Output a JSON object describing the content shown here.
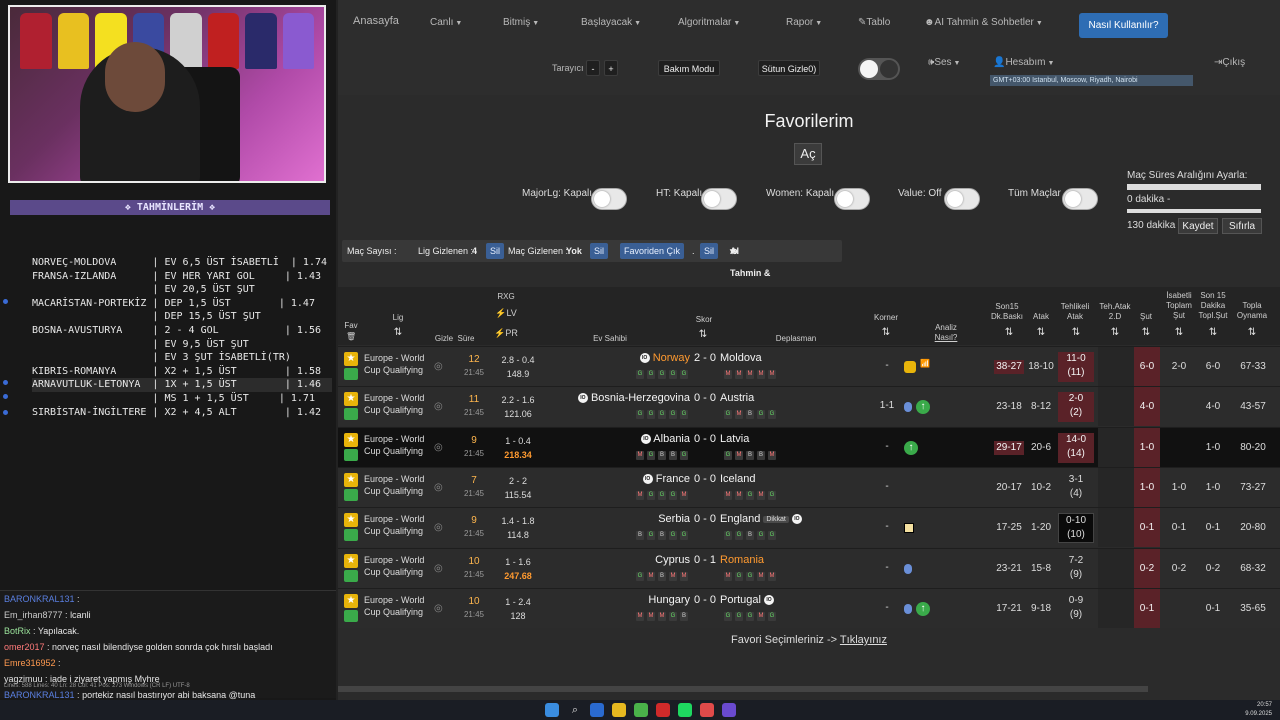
{
  "left": {
    "tahmin_title": "❖ TAHMİNLERİM ❖",
    "tahmin_lines": [
      "NORVEÇ-MOLDOVA      | EV 6,5 ÜST İSABETLİ  | 1.74",
      "FRANSA-IZLANDA      | EV HER YARI GOL     | 1.43",
      "                    | EV 20,5 ÜST ŞUT",
      "MACARİSTAN-PORTEKİZ | DEP 1,5 ÜST        | 1.47",
      "                    | DEP 15,5 ÜST ŞUT",
      "BOSNA-AVUSTURYA     | 2 - 4 GOL           | 1.56",
      "                    | EV 9,5 ÜST ŞUT",
      "                    | EV 3 ŞUT İSABETLİ(TR)",
      "KIBRIS-ROMANYA      | X2 + 1,5 ÜST        | 1.58",
      "ARNAVUTLUK-LETONYA  | 1X + 1,5 ÜST        | 1.46",
      "                    | MS 1 + 1,5 ÜST     | 1.71",
      "SIRBİSTAN-İNGİLTERE | X2 + 4,5 ALT        | 1.42"
    ],
    "chat": [
      {
        "user": "BARONKRAL131",
        "msg": "",
        "cls": "u1"
      },
      {
        "user": "Em_irhan8777",
        "msg": "lcanli",
        "cls": "u2"
      },
      {
        "user": "BotRix",
        "msg": "Yapılacak.",
        "cls": "bot"
      },
      {
        "user": "omer2017",
        "msg": "norveç nasıl bilendiyse golden sonrda çok hırslı başladı",
        "cls": "u3"
      },
      {
        "user": "Emre316952",
        "msg": "",
        "cls": "u4"
      },
      {
        "user": "yagzimuu",
        "msg": "iade i ziyaret yapmış Myhre",
        "cls": "u5"
      },
      {
        "user": "BARONKRAL131",
        "msg": "portekiz nasıl bastırıyor abi baksana @tuna",
        "cls": "u1"
      }
    ],
    "statusline": "Lines: 588  Lines: 40   Ln: 28  Col: 41  Pos: 273          Windows (CR LF)   UTF-8"
  },
  "nav": {
    "home": "Anasayfa",
    "items": [
      "Canlı",
      "Bitmiş",
      "Başlayacak",
      "Algoritmalar",
      "Rapor",
      "Tablo",
      "AI Tahmin & Sohbetler"
    ],
    "howto": "Nasıl Kullanılır?",
    "tarayici": "Tarayıcı",
    "minus": "-",
    "plus": "+",
    "bakim": "Bakım Modu",
    "sutun": "Sütun Gizle0)",
    "ses": "Ses",
    "hesabim": "Hesabım",
    "cikis": "Çıkış",
    "timezone": "GMT+03:00 Istanbul, Moscow, Riyadh, Nairobi"
  },
  "fav": {
    "title": "Favorilerim",
    "ac": "Aç",
    "toggles": [
      "MajorLg: Kapalı",
      "HT: Kapalı",
      "Women: Kapalı",
      "Value: Off",
      "Tüm Maçlar"
    ],
    "range_title": "Maç Süres Aralığını Ayarla:",
    "range_min": "0 dakika -",
    "range_max": "130 dakika",
    "kaydet": "Kaydet",
    "sifirla": "Sıfırla"
  },
  "filter": {
    "mac_sayisi": "Maç Sayısı :",
    "lig_gizlenen": "Lig Gizlenen :",
    "lig_gizlenen_val": "4",
    "sil1": "Sil",
    "mac_gizlenen": "Maç Gizlenen :",
    "mac_gizlenen_val": "Yok",
    "sil2": "Sil",
    "favoriden": "Favoriden Çık",
    "dot": ".",
    "sil3": "Sil",
    "ai": "AI Tahmin & Sohbetler"
  },
  "headers": {
    "fav": "Fav",
    "lig": "Lig",
    "gizle": "Gizle",
    "sure": "Süre",
    "rxg": "RXG",
    "lv": "LV",
    "pr": "PR",
    "ev": "Ev Sahibi",
    "skor": "Skor",
    "dep": "Deplasman",
    "korner": "Korner",
    "analiz": "Analiz",
    "nasil": "Nasıl?",
    "son15": "Son15",
    "dkbaski": "Dk.Baskı",
    "atak": "Atak",
    "tehlikeli": "Tehlikeli",
    "atak2": "Atak",
    "tehatak": "Teh.Atak",
    "tehatak2": "2.D",
    "sut": "Şut",
    "isabetli": "İsabetli",
    "toplam": "Toplam",
    "sut2": "Şut",
    "son15b": "Son 15",
    "dakika": "Dakika",
    "toplsut": "Topl.Şut",
    "topla": "Topla",
    "oynama": "Oynama"
  },
  "matches": [
    {
      "league": "Europe - World Cup Qualifying",
      "minute": "12",
      "time": "21:45",
      "odd": "2.8 - 0.4",
      "rxg": "148.9",
      "rxg_hi": false,
      "home": "Norway",
      "home_org": true,
      "home_io": true,
      "score": "2 - 0",
      "away": "Moldova",
      "away_org": false,
      "away_io": false,
      "dikkat": false,
      "hform": [
        "G",
        "G",
        "G",
        "G",
        "G"
      ],
      "aform": [
        "M",
        "M",
        "M",
        "M",
        "M"
      ],
      "korner": "-",
      "anz": "bag",
      "baski": "38-27",
      "baski_red": true,
      "atak": "18-10",
      "teh": "11-0",
      "teh2": "(11)",
      "teh_red": true,
      "teh_blk": false,
      "sut": "6-0",
      "isb": "2-0",
      "son15": "6-0",
      "oyn": "67-33",
      "dark": false
    },
    {
      "league": "Europe - World Cup Qualifying",
      "minute": "11",
      "time": "21:45",
      "odd": "2.2 - 1.6",
      "rxg": "121.06",
      "rxg_hi": false,
      "home": "Bosnia-Herzegovina",
      "home_org": false,
      "home_io": true,
      "score": "0 - 0",
      "away": "Austria",
      "away_org": false,
      "away_io": false,
      "dikkat": false,
      "hform": [
        "G",
        "G",
        "G",
        "G",
        "G"
      ],
      "aform": [
        "G",
        "M",
        "B",
        "G",
        "G"
      ],
      "korner": "1-1",
      "anz": "bomb-up",
      "baski": "23-18",
      "baski_red": false,
      "atak": "8-12",
      "teh": "2-0",
      "teh2": "(2)",
      "teh_red": true,
      "teh_blk": false,
      "sut": "4-0",
      "isb": "",
      "son15": "4-0",
      "oyn": "43-57",
      "dark": false
    },
    {
      "league": "Europe - World Cup Qualifying",
      "minute": "9",
      "time": "21:45",
      "odd": "1 - 0.4",
      "rxg": "218.34",
      "rxg_hi": true,
      "home": "Albania",
      "home_org": false,
      "home_io": true,
      "score": "0 - 0",
      "away": "Latvia",
      "away_org": false,
      "away_io": false,
      "dikkat": false,
      "hform": [
        "M",
        "G",
        "B",
        "B",
        "G"
      ],
      "aform": [
        "G",
        "M",
        "B",
        "B",
        "M"
      ],
      "korner": "-",
      "anz": "up",
      "baski": "29-17",
      "baski_red": true,
      "atak": "20-6",
      "teh": "14-0",
      "teh2": "(14)",
      "teh_red": true,
      "teh_blk": false,
      "sut": "1-0",
      "isb": "",
      "son15": "1-0",
      "oyn": "80-20",
      "dark": true
    },
    {
      "league": "Europe - World Cup Qualifying",
      "minute": "7",
      "time": "21:45",
      "odd": "2 - 2",
      "rxg": "115.54",
      "rxg_hi": false,
      "home": "France",
      "home_org": false,
      "home_io": true,
      "score": "0 - 0",
      "away": "Iceland",
      "away_org": false,
      "away_io": false,
      "dikkat": false,
      "hform": [
        "M",
        "G",
        "G",
        "G",
        "M"
      ],
      "aform": [
        "M",
        "M",
        "G",
        "M",
        "G"
      ],
      "korner": "-",
      "anz": "",
      "baski": "20-17",
      "baski_red": false,
      "atak": "10-2",
      "teh": "3-1",
      "teh2": "(4)",
      "teh_red": false,
      "teh_blk": false,
      "sut": "1-0",
      "isb": "1-0",
      "son15": "1-0",
      "oyn": "73-27",
      "dark": false
    },
    {
      "league": "Europe - World Cup Qualifying",
      "minute": "9",
      "time": "21:45",
      "odd": "1.4 - 1.8",
      "rxg": "114.8",
      "rxg_hi": false,
      "home": "Serbia",
      "home_org": false,
      "home_io": false,
      "score": "0 - 0",
      "away": "England",
      "away_org": false,
      "away_io": true,
      "dikkat": true,
      "hform": [
        "B",
        "G",
        "B",
        "G",
        "G"
      ],
      "aform": [
        "G",
        "G",
        "B",
        "G",
        "G"
      ],
      "korner": "-",
      "anz": "note",
      "baski": "17-25",
      "baski_red": false,
      "atak": "1-20",
      "teh": "0-10",
      "teh2": "(10)",
      "teh_red": false,
      "teh_blk": true,
      "sut": "0-1",
      "isb": "0-1",
      "son15": "0-1",
      "oyn": "20-80",
      "dark": false
    },
    {
      "league": "Europe - World Cup Qualifying",
      "minute": "10",
      "time": "21:45",
      "odd": "1 - 1.6",
      "rxg": "247.68",
      "rxg_hi": true,
      "home": "Cyprus",
      "home_org": false,
      "home_io": false,
      "score": "0 - 1",
      "away": "Romania",
      "away_org": true,
      "away_io": false,
      "dikkat": false,
      "hform": [
        "G",
        "M",
        "B",
        "M",
        "M"
      ],
      "aform": [
        "M",
        "G",
        "G",
        "M",
        "M"
      ],
      "korner": "-",
      "anz": "bomb",
      "baski": "23-21",
      "baski_red": false,
      "atak": "15-8",
      "teh": "7-2",
      "teh2": "(9)",
      "teh_red": false,
      "teh_blk": false,
      "sut": "0-2",
      "isb": "0-2",
      "son15": "0-2",
      "oyn": "68-32",
      "dark": false
    },
    {
      "league": "Europe - World Cup Qualifying",
      "minute": "10",
      "time": "21:45",
      "odd": "1 - 2.4",
      "rxg": "128",
      "rxg_hi": false,
      "home": "Hungary",
      "home_org": false,
      "home_io": false,
      "score": "0 - 0",
      "away": "Portugal",
      "away_org": false,
      "away_io": true,
      "dikkat": false,
      "hform": [
        "M",
        "M",
        "M",
        "G",
        "B"
      ],
      "aform": [
        "G",
        "G",
        "G",
        "M",
        "G"
      ],
      "korner": "-",
      "anz": "bomb-up",
      "baski": "17-21",
      "baski_red": false,
      "atak": "9-18",
      "teh": "0-9",
      "teh2": "(9)",
      "teh_red": false,
      "teh_blk": false,
      "sut": "0-1",
      "isb": "",
      "son15": "0-1",
      "oyn": "35-65",
      "dark": false
    }
  ],
  "footer_text": "Favori Seçimleriniz -> ",
  "footer_link": "Tıklayınız",
  "clock": {
    "time": "20:57",
    "date": "9.09.2025"
  }
}
